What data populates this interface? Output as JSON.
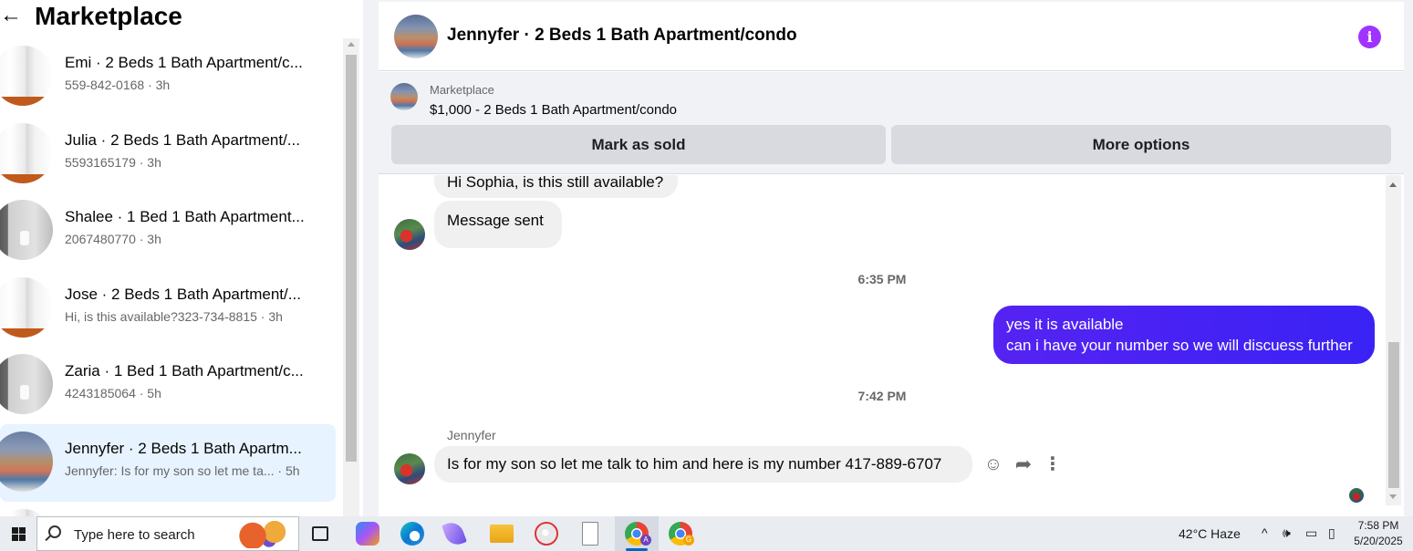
{
  "sidebar": {
    "title": "Marketplace",
    "back_icon": "arrow-left-icon",
    "conversations": [
      {
        "name": "Emi · 2 Beds 1 Bath Apartment/c...",
        "sub": "559-842-0168 · 3h",
        "thumb": "door"
      },
      {
        "name": "Julia · 2 Beds 1 Bath Apartment/...",
        "sub": "5593165179 · 3h",
        "thumb": "door"
      },
      {
        "name": "Shalee · 1 Bed 1 Bath Apartment...",
        "sub": "2067480770 · 3h",
        "thumb": "bath"
      },
      {
        "name": "Jose · 2 Beds 1 Bath Apartment/...",
        "sub": "Hi, is this available?323-734-8815 · 3h",
        "thumb": "door"
      },
      {
        "name": "Zaria · 1 Bed 1 Bath Apartment/c...",
        "sub": "4243185064 · 5h",
        "thumb": "bath"
      },
      {
        "name": "Jennyfer · 2 Beds 1 Bath Apartm...",
        "sub": "Jennyfer: Is for my son so let me ta... · 5h",
        "thumb": "pool",
        "active": true
      }
    ]
  },
  "chat": {
    "title": "Jennyfer · 2 Beds 1 Bath Apartment/condo",
    "info_icon": "info-icon",
    "listing": {
      "label": "Marketplace",
      "title": "$1,000 - 2 Beds 1 Bath Apartment/condo",
      "mark_sold": "Mark as sold",
      "more_options": "More options"
    },
    "messages": {
      "incoming_1": "Hi Sophia, is this still available?",
      "incoming_2": "Message sent",
      "time_1": "6:35 PM",
      "outgoing_line1": "yes it is available",
      "outgoing_line2": "can i have your number so we will discuess further",
      "time_2": "7:42 PM",
      "sender": "Jennyfer",
      "incoming_3": "Is for my son so let me talk to him and here is my number 417-889-6707"
    },
    "actions": {
      "emoji": "☺",
      "reply": "➦",
      "more": "⋮"
    }
  },
  "taskbar": {
    "search_placeholder": "Type here to search",
    "weather": "42°C  Haze",
    "tray_chevron": "^",
    "tray_speaker": "🕪",
    "tray_network": "▭",
    "tray_battery": "▯",
    "time": "7:58 PM",
    "date": "5/20/2025",
    "chrome_badge_1": "A",
    "chrome_badge_2": "G"
  }
}
